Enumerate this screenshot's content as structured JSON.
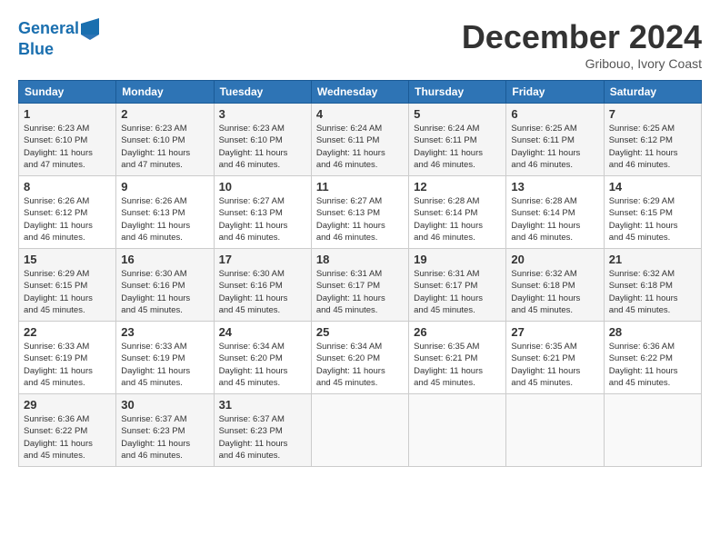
{
  "logo": {
    "line1": "General",
    "line2": "Blue"
  },
  "title": "December 2024",
  "subtitle": "Gribouo, Ivory Coast",
  "days_header": [
    "Sunday",
    "Monday",
    "Tuesday",
    "Wednesday",
    "Thursday",
    "Friday",
    "Saturday"
  ],
  "weeks": [
    [
      {
        "day": "1",
        "info": "Sunrise: 6:23 AM\nSunset: 6:10 PM\nDaylight: 11 hours\nand 47 minutes."
      },
      {
        "day": "2",
        "info": "Sunrise: 6:23 AM\nSunset: 6:10 PM\nDaylight: 11 hours\nand 47 minutes."
      },
      {
        "day": "3",
        "info": "Sunrise: 6:23 AM\nSunset: 6:10 PM\nDaylight: 11 hours\nand 46 minutes."
      },
      {
        "day": "4",
        "info": "Sunrise: 6:24 AM\nSunset: 6:11 PM\nDaylight: 11 hours\nand 46 minutes."
      },
      {
        "day": "5",
        "info": "Sunrise: 6:24 AM\nSunset: 6:11 PM\nDaylight: 11 hours\nand 46 minutes."
      },
      {
        "day": "6",
        "info": "Sunrise: 6:25 AM\nSunset: 6:11 PM\nDaylight: 11 hours\nand 46 minutes."
      },
      {
        "day": "7",
        "info": "Sunrise: 6:25 AM\nSunset: 6:12 PM\nDaylight: 11 hours\nand 46 minutes."
      }
    ],
    [
      {
        "day": "8",
        "info": "Sunrise: 6:26 AM\nSunset: 6:12 PM\nDaylight: 11 hours\nand 46 minutes."
      },
      {
        "day": "9",
        "info": "Sunrise: 6:26 AM\nSunset: 6:13 PM\nDaylight: 11 hours\nand 46 minutes."
      },
      {
        "day": "10",
        "info": "Sunrise: 6:27 AM\nSunset: 6:13 PM\nDaylight: 11 hours\nand 46 minutes."
      },
      {
        "day": "11",
        "info": "Sunrise: 6:27 AM\nSunset: 6:13 PM\nDaylight: 11 hours\nand 46 minutes."
      },
      {
        "day": "12",
        "info": "Sunrise: 6:28 AM\nSunset: 6:14 PM\nDaylight: 11 hours\nand 46 minutes."
      },
      {
        "day": "13",
        "info": "Sunrise: 6:28 AM\nSunset: 6:14 PM\nDaylight: 11 hours\nand 46 minutes."
      },
      {
        "day": "14",
        "info": "Sunrise: 6:29 AM\nSunset: 6:15 PM\nDaylight: 11 hours\nand 45 minutes."
      }
    ],
    [
      {
        "day": "15",
        "info": "Sunrise: 6:29 AM\nSunset: 6:15 PM\nDaylight: 11 hours\nand 45 minutes."
      },
      {
        "day": "16",
        "info": "Sunrise: 6:30 AM\nSunset: 6:16 PM\nDaylight: 11 hours\nand 45 minutes."
      },
      {
        "day": "17",
        "info": "Sunrise: 6:30 AM\nSunset: 6:16 PM\nDaylight: 11 hours\nand 45 minutes."
      },
      {
        "day": "18",
        "info": "Sunrise: 6:31 AM\nSunset: 6:17 PM\nDaylight: 11 hours\nand 45 minutes."
      },
      {
        "day": "19",
        "info": "Sunrise: 6:31 AM\nSunset: 6:17 PM\nDaylight: 11 hours\nand 45 minutes."
      },
      {
        "day": "20",
        "info": "Sunrise: 6:32 AM\nSunset: 6:18 PM\nDaylight: 11 hours\nand 45 minutes."
      },
      {
        "day": "21",
        "info": "Sunrise: 6:32 AM\nSunset: 6:18 PM\nDaylight: 11 hours\nand 45 minutes."
      }
    ],
    [
      {
        "day": "22",
        "info": "Sunrise: 6:33 AM\nSunset: 6:19 PM\nDaylight: 11 hours\nand 45 minutes."
      },
      {
        "day": "23",
        "info": "Sunrise: 6:33 AM\nSunset: 6:19 PM\nDaylight: 11 hours\nand 45 minutes."
      },
      {
        "day": "24",
        "info": "Sunrise: 6:34 AM\nSunset: 6:20 PM\nDaylight: 11 hours\nand 45 minutes."
      },
      {
        "day": "25",
        "info": "Sunrise: 6:34 AM\nSunset: 6:20 PM\nDaylight: 11 hours\nand 45 minutes."
      },
      {
        "day": "26",
        "info": "Sunrise: 6:35 AM\nSunset: 6:21 PM\nDaylight: 11 hours\nand 45 minutes."
      },
      {
        "day": "27",
        "info": "Sunrise: 6:35 AM\nSunset: 6:21 PM\nDaylight: 11 hours\nand 45 minutes."
      },
      {
        "day": "28",
        "info": "Sunrise: 6:36 AM\nSunset: 6:22 PM\nDaylight: 11 hours\nand 45 minutes."
      }
    ],
    [
      {
        "day": "29",
        "info": "Sunrise: 6:36 AM\nSunset: 6:22 PM\nDaylight: 11 hours\nand 45 minutes."
      },
      {
        "day": "30",
        "info": "Sunrise: 6:37 AM\nSunset: 6:23 PM\nDaylight: 11 hours\nand 46 minutes."
      },
      {
        "day": "31",
        "info": "Sunrise: 6:37 AM\nSunset: 6:23 PM\nDaylight: 11 hours\nand 46 minutes."
      },
      {
        "day": "",
        "info": ""
      },
      {
        "day": "",
        "info": ""
      },
      {
        "day": "",
        "info": ""
      },
      {
        "day": "",
        "info": ""
      }
    ]
  ]
}
